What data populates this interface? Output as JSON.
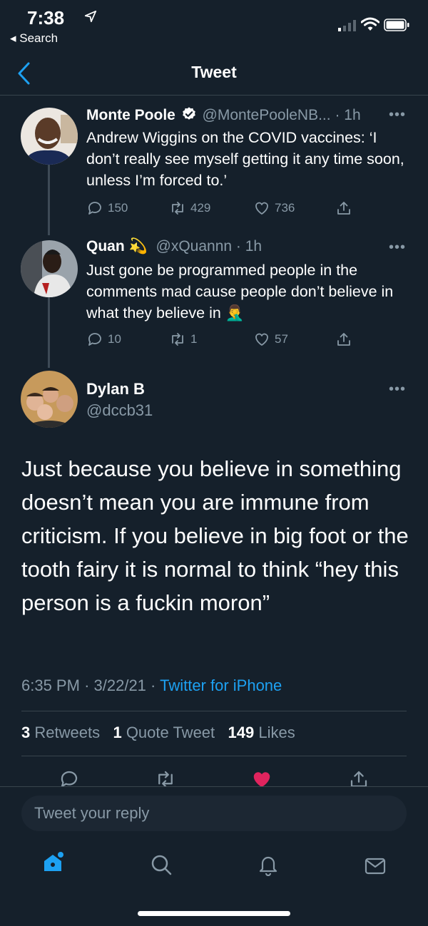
{
  "status": {
    "time": "7:38",
    "back_label": "◂ Search"
  },
  "header": {
    "title": "Tweet"
  },
  "thread": [
    {
      "name": "Monte Poole",
      "handle": "@MontePooleNB...",
      "time": "· 1h",
      "verified": true,
      "text": "Andrew Wiggins on the COVID vaccines: ‘I don’t really see myself getting it any time soon, unless I’m forced to.’",
      "replies": "150",
      "retweets": "429",
      "likes": "736"
    },
    {
      "name": "Quan",
      "handle": "@xQuannn",
      "time": "· 1h",
      "name_emoji": "💫",
      "text": "Just gone be programmed people in the comments mad cause people don’t believe in what they believe in",
      "text_emoji": "🤦‍♂️",
      "replies": "10",
      "retweets": "1",
      "likes": "57"
    }
  ],
  "main_tweet": {
    "name": "Dylan B",
    "handle": "@dccb31",
    "text": "Just because you believe in something doesn’t mean you are immune from criticism. If you believe in big foot or the tooth fairy it is normal to think “hey this person is a fuckin moron”",
    "time": "6:35 PM",
    "date": "3/22/21",
    "source": "Twitter for iPhone",
    "retweets_count": "3",
    "retweets_label": "Retweets",
    "quotes_count": "1",
    "quotes_label": "Quote Tweet",
    "likes_count": "149",
    "likes_label": "Likes"
  },
  "reply": {
    "placeholder": "Tweet your reply"
  },
  "colors": {
    "background": "#15202b",
    "accent": "#1da1f2",
    "like": "#e0245e",
    "muted": "#8899a6"
  },
  "icons": {
    "tabs": [
      "home-icon",
      "search-icon",
      "notifications-icon",
      "messages-icon"
    ]
  }
}
